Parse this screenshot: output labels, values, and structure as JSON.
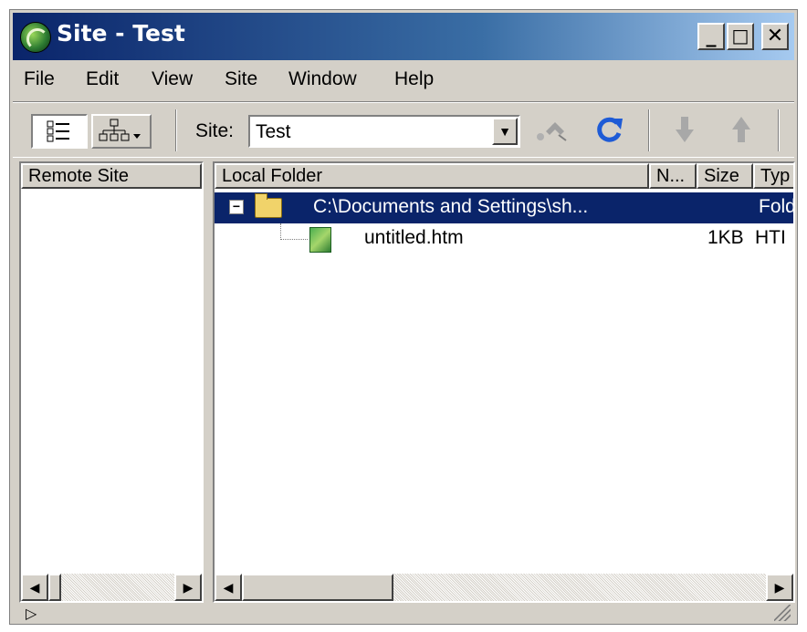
{
  "window": {
    "title": "Site - Test",
    "controls": {
      "minimize": "_",
      "maximize": "□",
      "close": "✕"
    }
  },
  "menu": [
    "File",
    "Edit",
    "View",
    "Site",
    "Window",
    "Help"
  ],
  "toolbar": {
    "site_label": "Site:",
    "site_value": "Test",
    "dropdown_icon": "▼",
    "icons": {
      "site_files_view": "site-files-view-icon",
      "site_map_view": "site-map-view-icon",
      "connect": "connect-icon",
      "refresh": "refresh-icon",
      "get": "down-arrow-icon",
      "put": "up-arrow-icon"
    }
  },
  "remote_pane": {
    "header": "Remote Site"
  },
  "local_pane": {
    "headers": [
      "Local Folder",
      "N...",
      "Size",
      "Typ"
    ],
    "rows": [
      {
        "name": "C:\\Documents and Settings\\sh...",
        "size": "",
        "type": "Fold",
        "selected": true,
        "expander": "−"
      },
      {
        "name": "untitled.htm",
        "size": "1KB",
        "type": "HTI",
        "selected": false
      }
    ]
  },
  "scroll": {
    "left": "◀",
    "right": "▶"
  },
  "status": {
    "arrow": "▷"
  },
  "colors": {
    "titlebar_start": "#0a246a",
    "titlebar_end": "#a6caf0",
    "selection": "#0a246a",
    "face": "#d4d0c8"
  }
}
